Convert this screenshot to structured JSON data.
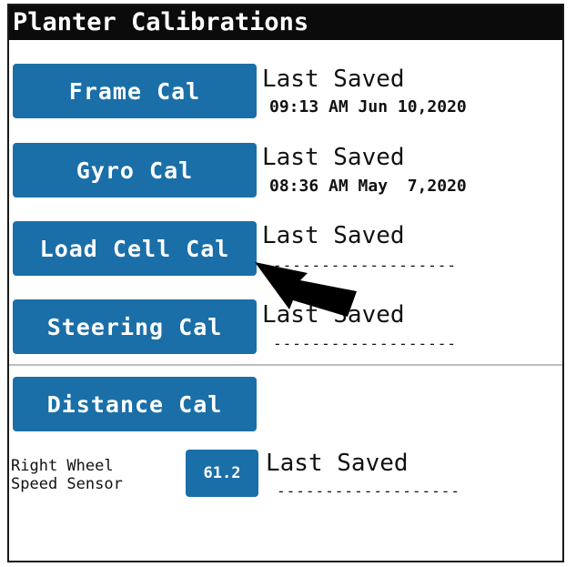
{
  "title": "Planter Calibrations",
  "calibrations": [
    {
      "button": "Frame Cal",
      "saved_label": "Last Saved",
      "saved_value": "09:13 AM Jun 10,2020"
    },
    {
      "button": "Gyro Cal",
      "saved_label": "Last Saved",
      "saved_value": "08:36 AM May  7,2020"
    },
    {
      "button": "Load Cell Cal",
      "saved_label": "Last Saved",
      "saved_value": "-------------------"
    },
    {
      "button": "Steering Cal",
      "saved_label": "Last Saved",
      "saved_value": "-------------------"
    }
  ],
  "distance": {
    "button": "Distance Cal",
    "sensor_label_line1": "Right Wheel",
    "sensor_label_line2": "Speed Sensor",
    "sensor_value": "61.2",
    "saved_label": "Last Saved",
    "saved_value": "-------------------"
  },
  "colors": {
    "button_blue": "#1a6fa8",
    "title_bg": "#0b0b0b"
  },
  "icons": {
    "pointer": "arrow-pointer-icon"
  }
}
